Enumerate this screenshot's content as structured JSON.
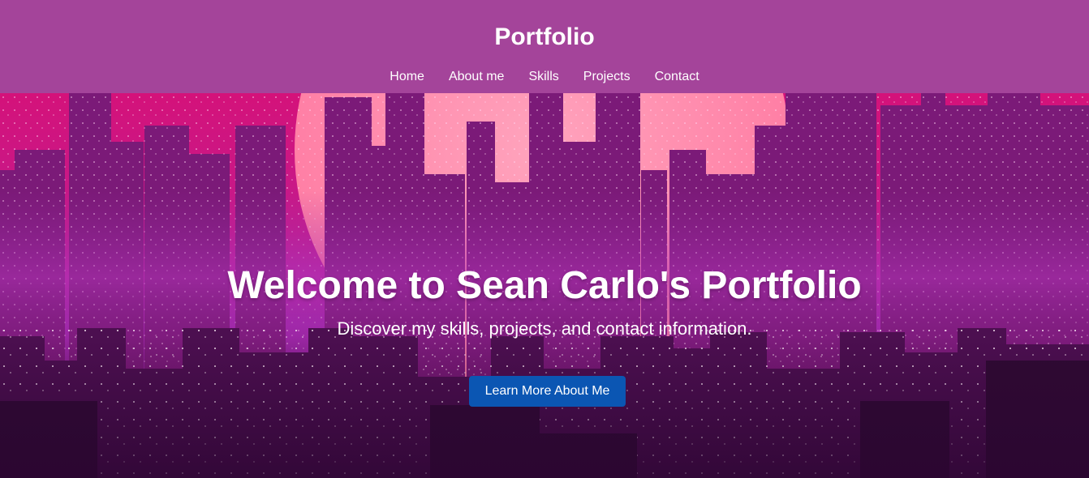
{
  "header": {
    "title": "Portfolio",
    "nav": [
      "Home",
      "About me",
      "Skills",
      "Projects",
      "Contact"
    ]
  },
  "hero": {
    "title": "Welcome to Sean Carlo's Portfolio",
    "subtitle": "Discover my skills, projects, and contact information.",
    "cta_label": "Learn More About Me"
  },
  "colors": {
    "header_bg": "#a4449a",
    "cta_bg": "#0b56b3",
    "sky_top": "#d4127a",
    "moon": "#ff8fb0",
    "city_glow": "#a52ab0",
    "city_dark": "#3a0c3d"
  },
  "icons": {
    "background": "city-skyline-image"
  }
}
